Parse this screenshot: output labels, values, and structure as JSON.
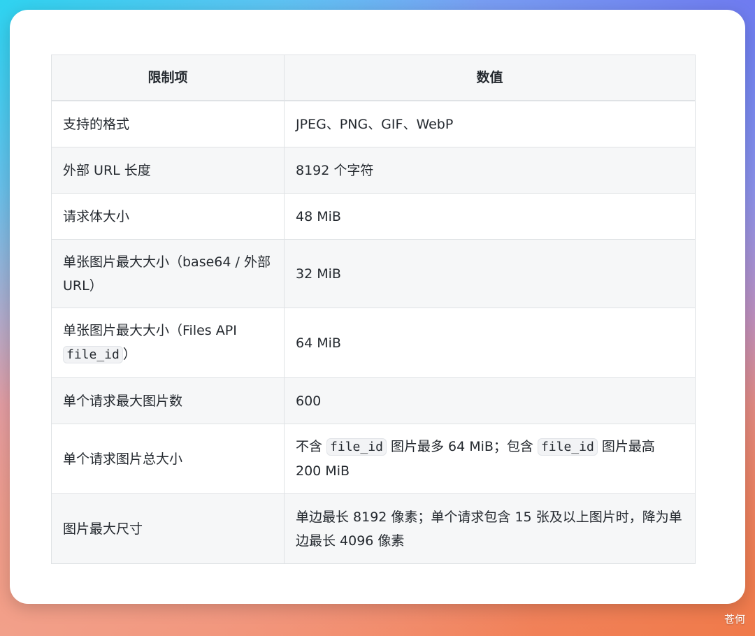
{
  "table": {
    "headers": [
      "限制项",
      "数值"
    ],
    "rows": [
      {
        "item": "支持的格式",
        "value": "JPEG、PNG、GIF、WebP"
      },
      {
        "item": "外部 URL 长度",
        "value": "8192 个字符"
      },
      {
        "item": "请求体大小",
        "value": "48 MiB"
      },
      {
        "item": "单张图片最大大小（base64 / 外部 URL）",
        "value": "32 MiB"
      },
      {
        "item_pre": "单张图片最大大小（Files API ",
        "item_code": "file_id",
        "item_post": "）",
        "value": "64 MiB"
      },
      {
        "item": "单个请求最大图片数",
        "value": "600"
      },
      {
        "item": "单个请求图片总大小",
        "value_parts": [
          "不含 ",
          "file_id",
          " 图片最多 64 MiB；包含 ",
          "file_id",
          " 图片最高 200 MiB"
        ]
      },
      {
        "item": "图片最大尺寸",
        "value": "单边最长 8192 像素；单个请求包含 15 张及以上图片时，降为单边最长 4096 像素"
      }
    ]
  },
  "watermark": "苍何"
}
